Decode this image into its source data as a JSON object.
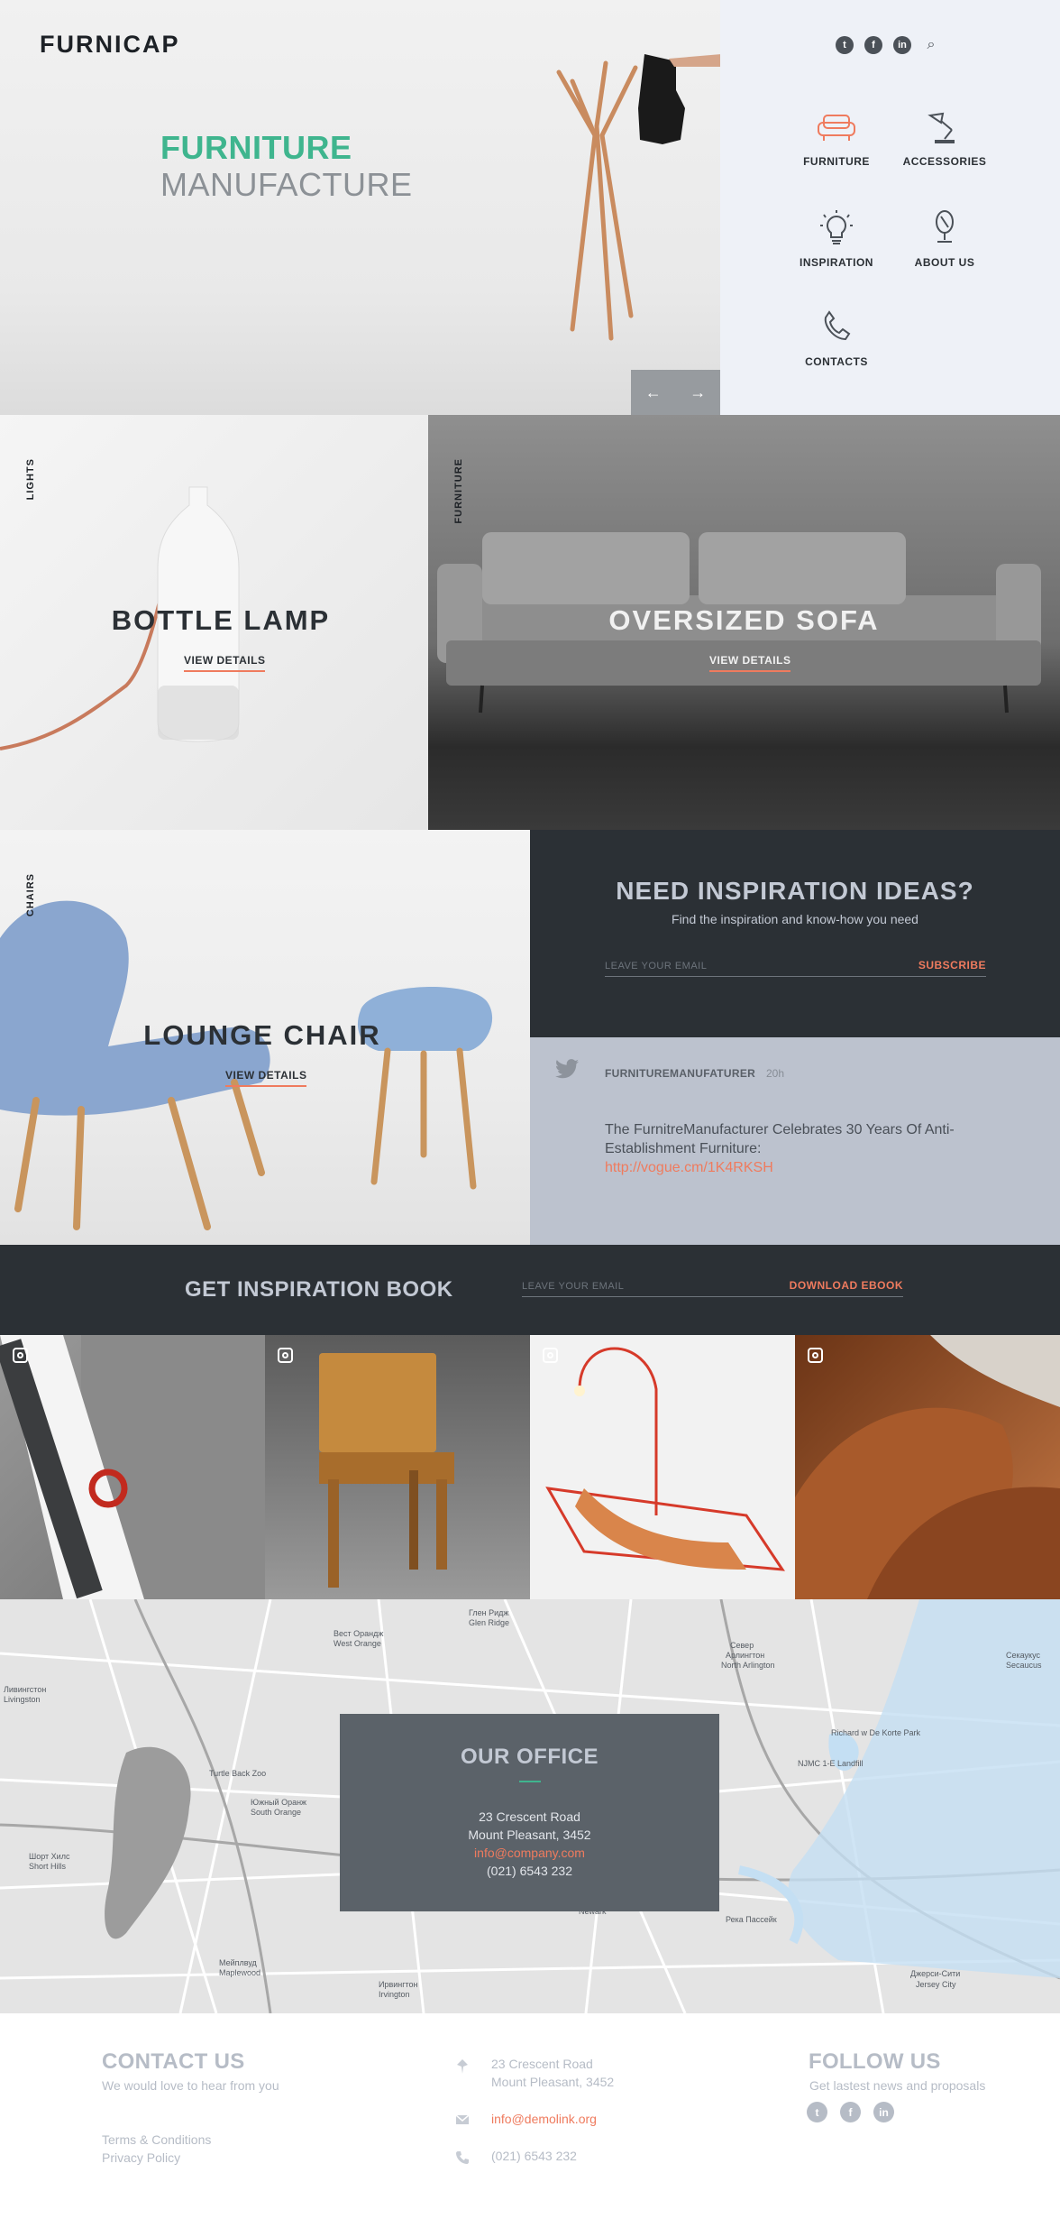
{
  "brand": {
    "logo": "FURNICAP"
  },
  "hero": {
    "title_line1": "FURNITURE",
    "title_line2": "MANUFACTURE",
    "prev_icon": "arrow-left-icon",
    "next_icon": "arrow-right-icon"
  },
  "header_social": [
    {
      "name": "twitter-icon",
      "glyph": "t"
    },
    {
      "name": "facebook-icon",
      "glyph": "f"
    },
    {
      "name": "linkedin-icon",
      "glyph": "in"
    },
    {
      "name": "search-icon",
      "glyph": "⌕"
    }
  ],
  "nav": {
    "furniture": "FURNITURE",
    "accessories": "ACCESSORIES",
    "inspiration": "INSPIRATION",
    "about": "ABOUT US",
    "contacts": "CONTACTS"
  },
  "products": {
    "lamp": {
      "category": "LIGHTS",
      "title": "BOTTLE LAMP",
      "link": "VIEW DETAILS"
    },
    "sofa": {
      "category": "FURNITURE",
      "title": "OVERSIZED SOFA",
      "link": "VIEW DETAILS"
    },
    "chair": {
      "category": "CHAIRS",
      "title": "LOUNGE CHAIR",
      "link": "VIEW DETAILS"
    }
  },
  "inspiration": {
    "title": "NEED INSPIRATION IDEAS?",
    "subtitle": "Find the inspiration and know-how you need",
    "email_placeholder": "LEAVE YOUR EMAIL",
    "button": "SUBSCRIBE"
  },
  "tweet": {
    "user": "FURNITUREMANUFATURER",
    "time": "20h",
    "text": "The FurnitreManufacturer Celebrates 30 Years Of Anti-Establishment Furniture:",
    "link": "http://vogue.cm/1K4RKSH"
  },
  "ebook": {
    "title": "GET INSPIRATION BOOK",
    "email_placeholder": "LEAVE YOUR EMAIL",
    "button": "DOWNLOAD EBOOK"
  },
  "map_labels": [
    "Глен Ридж",
    "Glen Ridge",
    "Вест Орандж",
    "West Orange",
    "Ливингстон",
    "Livingston",
    "Север",
    "Арлингтон",
    "North Arlington",
    "Secaucus",
    "Секаукус",
    "Turtle Back Zoo",
    "Южный Оранж",
    "South Orange",
    "Шорт Хилс",
    "Short Hills",
    "Ньюарк",
    "Newark",
    "Мейплвуд",
    "Maplewood",
    "Ирвингтон",
    "Irvington",
    "Джерси-Сити",
    "Jersey City",
    "NJMC 1-E Landfill",
    "Richard w De Korte Park",
    "Река Пассейк"
  ],
  "office": {
    "title": "OUR OFFICE",
    "address1": "23 Crescent Road",
    "address2": "Mount Pleasant, 3452",
    "email": "info@company.com",
    "phone": "(021) 6543 232"
  },
  "footer": {
    "contact_title": "CONTACT US",
    "contact_sub": "We would love to hear from you",
    "terms": "Terms & Conditions",
    "privacy": "Privacy Policy",
    "address1": "23 Crescent Road",
    "address2": "Mount Pleasant, 3452",
    "email": "info@demolink.org",
    "phone": "(021) 6543 232",
    "follow_title": "FOLLOW US",
    "follow_sub": "Get lastest news and proposals",
    "social": [
      {
        "name": "twitter-icon",
        "glyph": "t"
      },
      {
        "name": "facebook-icon",
        "glyph": "f"
      },
      {
        "name": "linkedin-icon",
        "glyph": "in"
      }
    ]
  },
  "colors": {
    "accent_green": "#3fb58e",
    "accent_orange": "#ef7b5e",
    "dark_panel": "#2b3035",
    "light_panel": "#eef1f7"
  }
}
